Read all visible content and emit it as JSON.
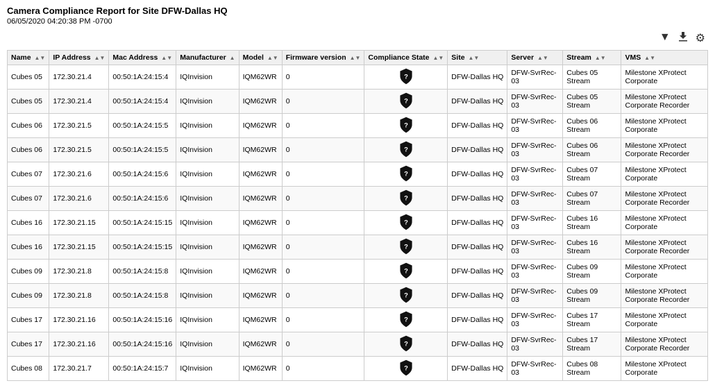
{
  "report": {
    "title": "Camera Compliance Report for Site DFW-Dallas HQ",
    "date": "06/05/2020 04:20:38 PM -0700"
  },
  "toolbar": {
    "filter_icon": "▼",
    "download_icon": "⬇",
    "settings_icon": "⚙"
  },
  "table": {
    "columns": [
      {
        "id": "name",
        "label": "Name"
      },
      {
        "id": "ip",
        "label": "IP Address"
      },
      {
        "id": "mac",
        "label": "Mac Address"
      },
      {
        "id": "manufacturer",
        "label": "Manufacturer"
      },
      {
        "id": "model",
        "label": "Model"
      },
      {
        "id": "firmware",
        "label": "Firmware version"
      },
      {
        "id": "compliance",
        "label": "Compliance State"
      },
      {
        "id": "site",
        "label": "Site"
      },
      {
        "id": "server",
        "label": "Server"
      },
      {
        "id": "stream",
        "label": "Stream"
      },
      {
        "id": "vms",
        "label": "VMS"
      }
    ],
    "rows": [
      {
        "name": "Cubes 05",
        "ip": "172.30.21.4",
        "mac": "00:50:1A:24:15:4",
        "manufacturer": "IQInvision",
        "model": "IQM62WR",
        "firmware": "0",
        "site": "DFW-Dallas HQ",
        "server": "DFW-SvrRec-03",
        "stream": "Cubes 05 Stream",
        "vms": "Milestone XProtect Corporate"
      },
      {
        "name": "Cubes 05",
        "ip": "172.30.21.4",
        "mac": "00:50:1A:24:15:4",
        "manufacturer": "IQInvision",
        "model": "IQM62WR",
        "firmware": "0",
        "site": "DFW-Dallas HQ",
        "server": "DFW-SvrRec-03",
        "stream": "Cubes 05 Stream",
        "vms": "Milestone XProtect Corporate Recorder"
      },
      {
        "name": "Cubes 06",
        "ip": "172.30.21.5",
        "mac": "00:50:1A:24:15:5",
        "manufacturer": "IQInvision",
        "model": "IQM62WR",
        "firmware": "0",
        "site": "DFW-Dallas HQ",
        "server": "DFW-SvrRec-03",
        "stream": "Cubes 06 Stream",
        "vms": "Milestone XProtect Corporate"
      },
      {
        "name": "Cubes 06",
        "ip": "172.30.21.5",
        "mac": "00:50:1A:24:15:5",
        "manufacturer": "IQInvision",
        "model": "IQM62WR",
        "firmware": "0",
        "site": "DFW-Dallas HQ",
        "server": "DFW-SvrRec-03",
        "stream": "Cubes 06 Stream",
        "vms": "Milestone XProtect Corporate Recorder"
      },
      {
        "name": "Cubes 07",
        "ip": "172.30.21.6",
        "mac": "00:50:1A:24:15:6",
        "manufacturer": "IQInvision",
        "model": "IQM62WR",
        "firmware": "0",
        "site": "DFW-Dallas HQ",
        "server": "DFW-SvrRec-03",
        "stream": "Cubes 07 Stream",
        "vms": "Milestone XProtect Corporate"
      },
      {
        "name": "Cubes 07",
        "ip": "172.30.21.6",
        "mac": "00:50:1A:24:15:6",
        "manufacturer": "IQInvision",
        "model": "IQM62WR",
        "firmware": "0",
        "site": "DFW-Dallas HQ",
        "server": "DFW-SvrRec-03",
        "stream": "Cubes 07 Stream",
        "vms": "Milestone XProtect Corporate Recorder"
      },
      {
        "name": "Cubes 16",
        "ip": "172.30.21.15",
        "mac": "00:50:1A:24:15:15",
        "manufacturer": "IQInvision",
        "model": "IQM62WR",
        "firmware": "0",
        "site": "DFW-Dallas HQ",
        "server": "DFW-SvrRec-03",
        "stream": "Cubes 16 Stream",
        "vms": "Milestone XProtect Corporate"
      },
      {
        "name": "Cubes 16",
        "ip": "172.30.21.15",
        "mac": "00:50:1A:24:15:15",
        "manufacturer": "IQInvision",
        "model": "IQM62WR",
        "firmware": "0",
        "site": "DFW-Dallas HQ",
        "server": "DFW-SvrRec-03",
        "stream": "Cubes 16 Stream",
        "vms": "Milestone XProtect Corporate Recorder"
      },
      {
        "name": "Cubes 09",
        "ip": "172.30.21.8",
        "mac": "00:50:1A:24:15:8",
        "manufacturer": "IQInvision",
        "model": "IQM62WR",
        "firmware": "0",
        "site": "DFW-Dallas HQ",
        "server": "DFW-SvrRec-03",
        "stream": "Cubes 09 Stream",
        "vms": "Milestone XProtect Corporate"
      },
      {
        "name": "Cubes 09",
        "ip": "172.30.21.8",
        "mac": "00:50:1A:24:15:8",
        "manufacturer": "IQInvision",
        "model": "IQM62WR",
        "firmware": "0",
        "site": "DFW-Dallas HQ",
        "server": "DFW-SvrRec-03",
        "stream": "Cubes 09 Stream",
        "vms": "Milestone XProtect Corporate Recorder"
      },
      {
        "name": "Cubes 17",
        "ip": "172.30.21.16",
        "mac": "00:50:1A:24:15:16",
        "manufacturer": "IQInvision",
        "model": "IQM62WR",
        "firmware": "0",
        "site": "DFW-Dallas HQ",
        "server": "DFW-SvrRec-03",
        "stream": "Cubes 17 Stream",
        "vms": "Milestone XProtect Corporate"
      },
      {
        "name": "Cubes 17",
        "ip": "172.30.21.16",
        "mac": "00:50:1A:24:15:16",
        "manufacturer": "IQInvision",
        "model": "IQM62WR",
        "firmware": "0",
        "site": "DFW-Dallas HQ",
        "server": "DFW-SvrRec-03",
        "stream": "Cubes 17 Stream",
        "vms": "Milestone XProtect Corporate Recorder"
      },
      {
        "name": "Cubes 08",
        "ip": "172.30.21.7",
        "mac": "00:50:1A:24:15:7",
        "manufacturer": "IQInvision",
        "model": "IQM62WR",
        "firmware": "0",
        "site": "DFW-Dallas HQ",
        "server": "DFW-SvrRec-03",
        "stream": "Cubes 08 Stream",
        "vms": "Milestone XProtect Corporate"
      }
    ]
  }
}
